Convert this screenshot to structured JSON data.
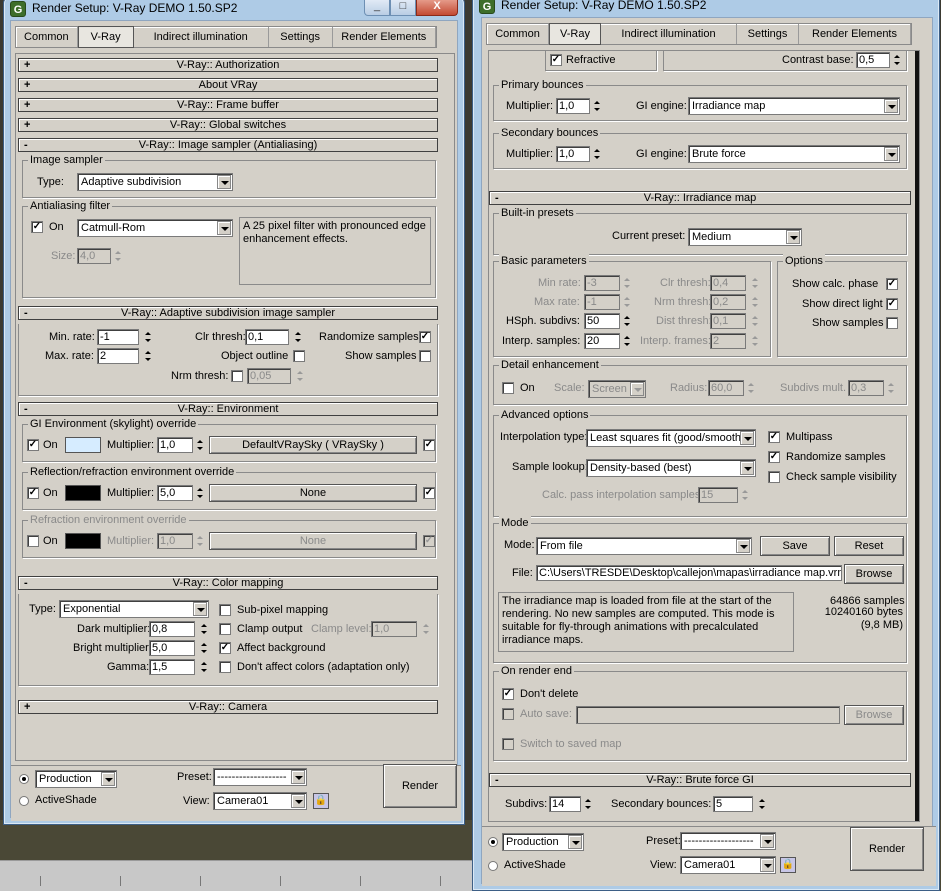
{
  "left": {
    "title": "Render Setup: V-Ray DEMO 1.50.SP2",
    "tabs": [
      "Common",
      "V-Ray",
      "Indirect illumination",
      "Settings",
      "Render Elements"
    ],
    "rollouts": {
      "authorization": "V-Ray:: Authorization",
      "about": "About VRay",
      "frame_buffer": "V-Ray:: Frame buffer",
      "global_switches": "V-Ray:: Global switches",
      "image_sampler": "V-Ray:: Image sampler (Antialiasing)",
      "adaptive": "V-Ray:: Adaptive subdivision image sampler",
      "environment": "V-Ray:: Environment",
      "color_mapping": "V-Ray:: Color mapping",
      "camera": "V-Ray:: Camera"
    },
    "image_sampler": {
      "group": "Image sampler",
      "type_label": "Type:",
      "type_value": "Adaptive subdivision"
    },
    "aa_filter": {
      "group": "Antialiasing filter",
      "on_label": "On",
      "filter": "Catmull-Rom",
      "description": "A 25 pixel filter with pronounced edge enhancement effects.",
      "size_label": "Size:",
      "size_value": "4,0"
    },
    "adaptive": {
      "min_rate_label": "Min. rate:",
      "min_rate": "-1",
      "max_rate_label": "Max. rate:",
      "max_rate": "2",
      "clr_thresh_label": "Clr thresh:",
      "clr_thresh": "0,1",
      "object_outline": "Object outline",
      "nrm_thresh_label": "Nrm thresh:",
      "nrm_thresh": "0,05",
      "randomize": "Randomize samples",
      "show_samples": "Show samples"
    },
    "environment": {
      "gi_group": "GI Environment (skylight) override",
      "refl_group": "Reflection/refraction environment override",
      "refr_group": "Refraction environment override",
      "on_label": "On",
      "multiplier_label": "Multiplier:",
      "gi_mult": "1,0",
      "gi_map": "DefaultVRaySky  ( VRaySky )",
      "refl_mult": "5,0",
      "refl_map": "None",
      "refr_mult": "1,0",
      "refr_map": "None",
      "gi_color": "#d6ecff",
      "refl_color": "#000000",
      "refr_color": "#000000"
    },
    "color_mapping": {
      "type_label": "Type:",
      "type_value": "Exponential",
      "dark_label": "Dark multiplier:",
      "dark": "0,8",
      "bright_label": "Bright multiplier:",
      "bright": "5,0",
      "gamma_label": "Gamma:",
      "gamma": "1,5",
      "subpixel": "Sub-pixel mapping",
      "clamp": "Clamp output",
      "clamp_level_label": "Clamp level:",
      "clamp_level": "1,0",
      "affect_bg": "Affect background",
      "dont_affect": "Don't affect colors (adaptation only)"
    },
    "footer": {
      "production": "Production",
      "activeshade": "ActiveShade",
      "preset_label": "Preset:",
      "preset_value": "-------------------",
      "view_label": "View:",
      "view_value": "Camera01",
      "render": "Render"
    }
  },
  "right": {
    "title": "Render Setup: V-Ray DEMO 1.50.SP2",
    "tabs": [
      "Common",
      "V-Ray",
      "Indirect illumination",
      "Settings",
      "Render Elements"
    ],
    "top": {
      "refractive": "Refractive",
      "contrast_base_label": "Contrast base:",
      "contrast_base": "0,5"
    },
    "primary": {
      "group": "Primary bounces",
      "multiplier_label": "Multiplier:",
      "multiplier": "1,0",
      "engine_label": "GI engine:",
      "engine": "Irradiance map"
    },
    "secondary": {
      "group": "Secondary bounces",
      "multiplier_label": "Multiplier:",
      "multiplier": "1,0",
      "engine_label": "GI engine:",
      "engine": "Brute force"
    },
    "irradiance_header": "V-Ray:: Irradiance map",
    "presets": {
      "group": "Built-in presets",
      "current_label": "Current preset:",
      "current": "Medium"
    },
    "basic": {
      "group": "Basic parameters",
      "min_rate_label": "Min rate:",
      "min_rate": "-3",
      "max_rate_label": "Max rate:",
      "max_rate": "-1",
      "hsph_label": "HSph. subdivs:",
      "hsph": "50",
      "interp_label": "Interp. samples:",
      "interp": "20",
      "clr_label": "Clr thresh:",
      "clr": "0,4",
      "nrm_label": "Nrm thresh:",
      "nrm": "0,2",
      "dist_label": "Dist thresh:",
      "dist": "0,1",
      "frames_label": "Interp. frames:",
      "frames": "2"
    },
    "options": {
      "group": "Options",
      "calc_phase": "Show calc. phase",
      "direct_light": "Show direct light",
      "show_samples": "Show samples"
    },
    "detail": {
      "group": "Detail enhancement",
      "on_label": "On",
      "scale_label": "Scale:",
      "scale": "Screen",
      "radius_label": "Radius:",
      "radius": "60,0",
      "subdivs_label": "Subdivs mult.",
      "subdivs": "0,3"
    },
    "advanced": {
      "group": "Advanced options",
      "interp_type_label": "Interpolation type:",
      "interp_type": "Least squares fit (good/smooth",
      "lookup_label": "Sample lookup:",
      "lookup": "Density-based (best)",
      "calc_pass_label": "Calc. pass interpolation samples:",
      "calc_pass": "15",
      "multipass": "Multipass",
      "randomize": "Randomize samples",
      "visibility": "Check sample visibility"
    },
    "mode": {
      "group": "Mode",
      "mode_label": "Mode:",
      "mode": "From file",
      "save": "Save",
      "reset": "Reset",
      "file_label": "File:",
      "file": "C:\\Users\\TRESDE\\Desktop\\callejon\\mapas\\irradiance map.vrmap",
      "browse": "Browse",
      "description": "The irradiance map is loaded from file at the start of the rendering. No new samples are computed. This mode is suitable for fly-through animations with precalculated irradiance maps.",
      "samples": "64866 samples",
      "bytes": "10240160 bytes (9,8 MB)"
    },
    "render_end": {
      "group": "On render end",
      "dont_delete": "Don't delete",
      "auto_save": "Auto save:",
      "browse": "Browse",
      "switch": "Switch to saved map"
    },
    "brute_header": "V-Ray:: Brute force GI",
    "brute": {
      "subdivs_label": "Subdivs:",
      "subdivs": "14",
      "bounces_label": "Secondary bounces:",
      "bounces": "5"
    },
    "footer": {
      "production": "Production",
      "activeshade": "ActiveShade",
      "preset_label": "Preset:",
      "preset_value": "-------------------",
      "view_label": "View:",
      "view_value": "Camera01",
      "render": "Render"
    }
  },
  "icons": {
    "app": "3ds-max-icon",
    "lock": "lock-icon",
    "check": "✓"
  }
}
